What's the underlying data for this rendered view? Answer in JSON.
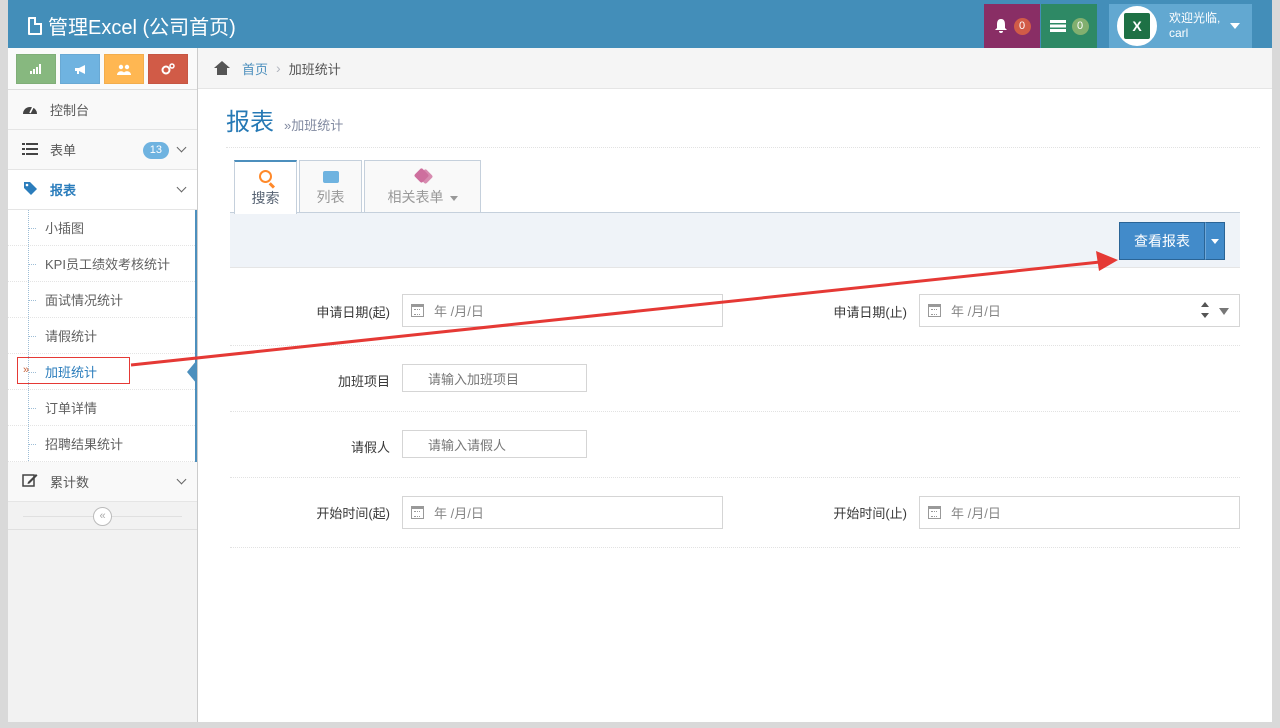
{
  "app": {
    "title": "管理Excel (公司首页)"
  },
  "nav": {
    "notifications_count": "0",
    "tasks_count": "0",
    "user_greeting": "欢迎光临,",
    "user_name": "carl",
    "avatar_letter": "X"
  },
  "sidebar": {
    "shortcuts": [
      "signal-icon",
      "bullhorn-icon",
      "users-icon",
      "cogs-icon"
    ],
    "menu": {
      "dashboard": "控制台",
      "forms": "表单",
      "forms_count": "13",
      "reports": "报表",
      "counters": "累计数"
    },
    "report_items": [
      "小插图",
      "KPI员工绩效考核统计",
      "面试情况统计",
      "请假统计",
      "加班统计",
      "订单详情",
      "招聘结果统计"
    ],
    "collapse_glyph": "«"
  },
  "breadcrumb": {
    "home": "首页",
    "separator": "›",
    "current": "加班统计"
  },
  "page": {
    "title": "报表",
    "subtitle": "»加班统计"
  },
  "tabs": {
    "search": "搜索",
    "list": "列表",
    "related": "相关表单"
  },
  "toolbar": {
    "view_report": "查看报表"
  },
  "form": {
    "apply_date_start_label": "申请日期(起)",
    "apply_date_end_label": "申请日期(止)",
    "date_placeholder": "年 /月/日",
    "overtime_item_label": "加班项目",
    "overtime_item_placeholder": "请输入加班项目",
    "leave_person_label": "请假人",
    "leave_person_placeholder": "请输入请假人",
    "start_time_start_label": "开始时间(起)",
    "start_time_end_label": "开始时间(止)"
  },
  "colors": {
    "navbar": "#438eb9",
    "accent": "#2b7dbc",
    "annotation": "#e53935",
    "button": "#428bca"
  }
}
